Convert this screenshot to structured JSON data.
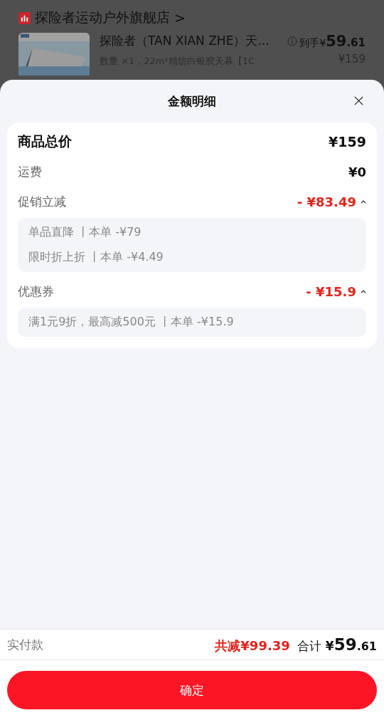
{
  "background": {
    "store": {
      "name": "探险者运动户外旗舰店",
      "arrow": ">"
    },
    "product": {
      "title": "探险者（TAN XIAN ZHE）天...",
      "spec": "数量 ×1，22m²精纺白银胶天幕【1C",
      "price_label": "到手¥",
      "price_big": "59",
      "price_small": ".61",
      "original_price": "¥159"
    }
  },
  "sheet": {
    "title": "金额明细",
    "rows": [
      {
        "kind": "total",
        "label": "商品总价",
        "amount": "¥159"
      },
      {
        "kind": "plain",
        "label": "运费",
        "amount": "¥0"
      },
      {
        "kind": "discount",
        "label": "促销立减",
        "amount": "- ¥83.49",
        "expanded": true,
        "details": [
          "单品直降 丨本单 -¥79",
          "限时折上折 丨本单 -¥4.49"
        ]
      },
      {
        "kind": "discount",
        "label": "优惠券",
        "amount": "- ¥15.9",
        "expanded": true,
        "details": [
          "满1元9折，最高减500元 丨本单 -¥15.9"
        ]
      }
    ]
  },
  "footer": {
    "label": "实付款",
    "saved": "共减¥99.39",
    "total_label": "合计",
    "total_currency": "¥",
    "total_big": "59",
    "total_small": ".61",
    "confirm": "确定"
  }
}
